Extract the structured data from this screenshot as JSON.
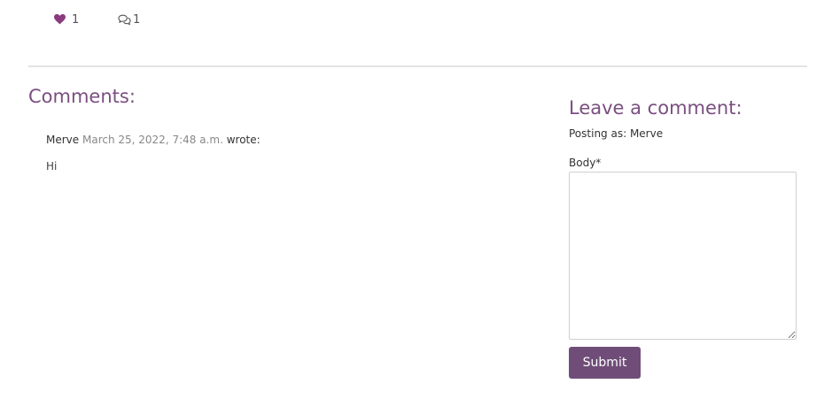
{
  "post_stats": {
    "like_count": "1",
    "comment_count": "1",
    "like_icon": "heart-icon",
    "comment_icon": "comments-icon"
  },
  "comments_section": {
    "heading": "Comments:",
    "comments": [
      {
        "author": "Merve",
        "date": "March 25, 2022, 7:48 a.m.",
        "wrote_label": "wrote:",
        "body": "Hi"
      }
    ]
  },
  "comment_form": {
    "heading": "Leave a comment:",
    "posting_as": "Posting as: Merve",
    "body_label": "Body*",
    "body_value": "",
    "submit_label": "Submit"
  },
  "colors": {
    "accent": "#704d78",
    "heading": "#7a4f80",
    "heart": "#8b3a7e"
  }
}
